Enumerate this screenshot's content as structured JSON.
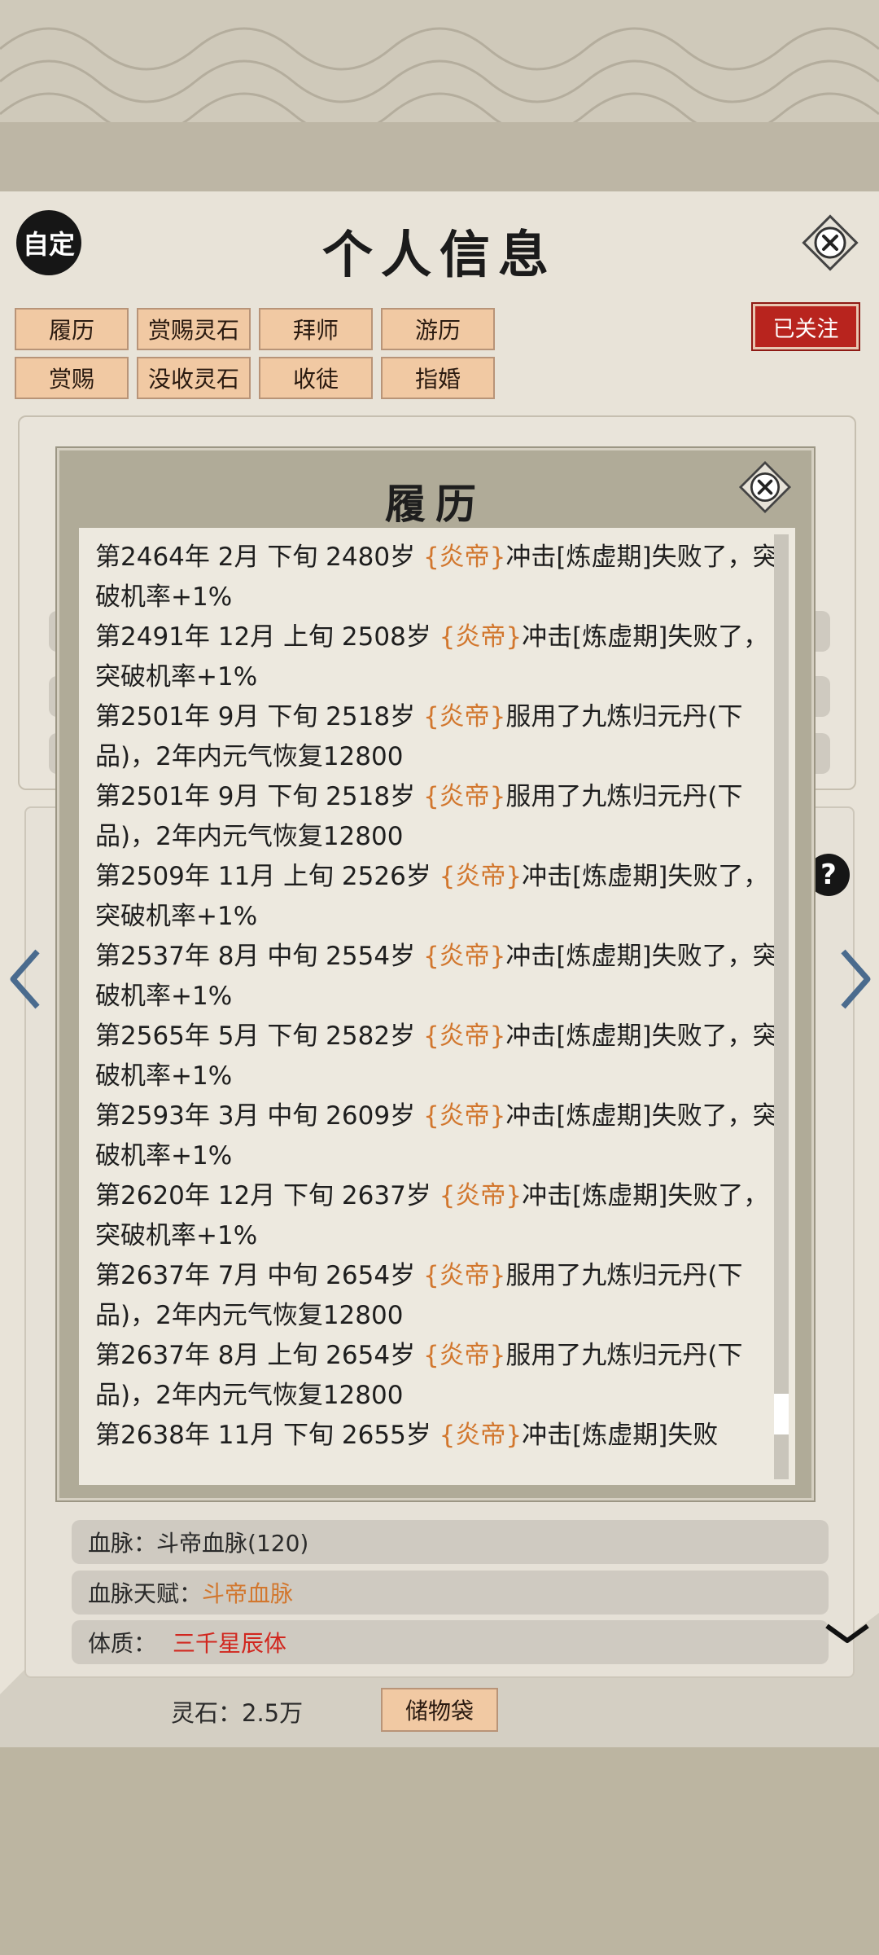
{
  "header": {
    "title": "个人信息",
    "auto_label": "自定"
  },
  "actions": {
    "row1": [
      "履历",
      "赏赐灵石",
      "拜师",
      "游历"
    ],
    "row2": [
      "赏赐",
      "没收灵石",
      "收徒",
      "指婚"
    ],
    "follow_label": "已关注"
  },
  "profile": {
    "bloodline_label": "血脉：",
    "bloodline_value": "斗帝血脉(120)",
    "bloodline_talent_label": "血脉天赋：",
    "bloodline_talent_value": "斗帝血脉",
    "physique_label": "体质：",
    "physique_value": "三千星辰体",
    "spirit_stones": "灵石：2.5万",
    "storage_bag_label": "储物袋"
  },
  "modal": {
    "title": "履历",
    "entries": [
      {
        "pre": "第2464年 2月 下旬  2480岁  ",
        "who": "{炎帝}",
        "post": "冲击[炼虚期]失败了，突破机率+1%"
      },
      {
        "pre": "第2491年 12月 上旬  2508岁  ",
        "who": "{炎帝}",
        "post": "冲击[炼虚期]失败了，突破机率+1%"
      },
      {
        "pre": "第2501年 9月 下旬  2518岁  ",
        "who": "{炎帝}",
        "post": "服用了九炼归元丹(下品)，2年内元气恢复12800"
      },
      {
        "pre": "第2501年 9月 下旬  2518岁  ",
        "who": "{炎帝}",
        "post": "服用了九炼归元丹(下品)，2年内元气恢复12800"
      },
      {
        "pre": "第2509年 11月 上旬  2526岁  ",
        "who": "{炎帝}",
        "post": "冲击[炼虚期]失败了，突破机率+1%"
      },
      {
        "pre": "第2537年 8月 中旬  2554岁  ",
        "who": "{炎帝}",
        "post": "冲击[炼虚期]失败了，突破机率+1%"
      },
      {
        "pre": "第2565年 5月 下旬  2582岁  ",
        "who": "{炎帝}",
        "post": "冲击[炼虚期]失败了，突破机率+1%"
      },
      {
        "pre": "第2593年 3月 中旬  2609岁  ",
        "who": "{炎帝}",
        "post": "冲击[炼虚期]失败了，突破机率+1%"
      },
      {
        "pre": "第2620年 12月 下旬  2637岁  ",
        "who": "{炎帝}",
        "post": "冲击[炼虚期]失败了，突破机率+1%"
      },
      {
        "pre": "第2637年 7月 中旬  2654岁  ",
        "who": "{炎帝}",
        "post": "服用了九炼归元丹(下品)，2年内元气恢复12800"
      },
      {
        "pre": "第2637年 8月 上旬  2654岁  ",
        "who": "{炎帝}",
        "post": "服用了九炼归元丹(下品)，2年内元气恢复12800"
      },
      {
        "pre": "第2638年 11月 下旬  2655岁  ",
        "who": "{炎帝}",
        "post": "冲击[炼虚期]失败"
      }
    ]
  },
  "colors": {
    "accent": "#d2772e",
    "follow": "#b8241e",
    "physique": "#d1271f"
  },
  "icons": {
    "close": "close-icon",
    "help": "help-icon",
    "prev": "chevron-left-icon",
    "next": "chevron-right-icon",
    "collapse": "chevron-down-icon"
  }
}
